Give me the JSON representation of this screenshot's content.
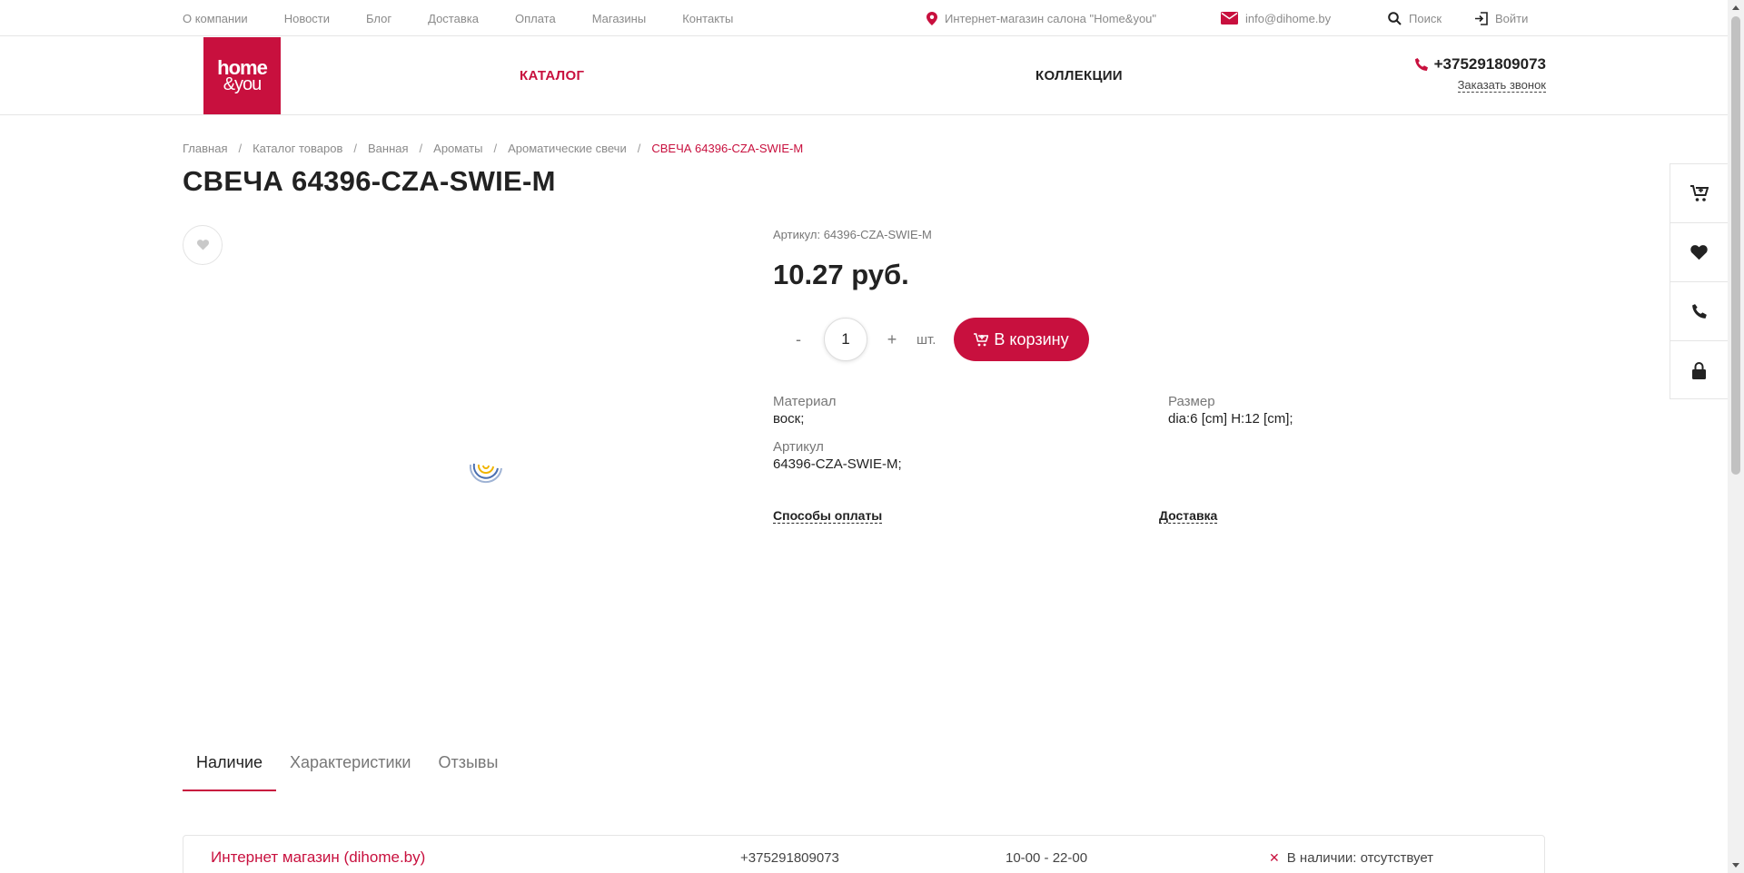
{
  "topnav": {
    "items": [
      "О компании",
      "Новости",
      "Блог",
      "Доставка",
      "Оплата",
      "Магазины",
      "Контакты"
    ]
  },
  "topinfo": {
    "store": "Интернет-магазин салона \"Home&you\"",
    "email": "info@dihome.by",
    "search": "Поиск",
    "login": "Войти"
  },
  "header": {
    "logo_line1": "home",
    "logo_line2": "&you",
    "catalog": "КАТАЛОГ",
    "collections": "КОЛЛЕКЦИИ",
    "phone": "+375291809073",
    "callback": "Заказать звонок"
  },
  "breadcrumb": {
    "items": [
      "Главная",
      "Каталог товаров",
      "Ванная",
      "Ароматы",
      "Ароматические свечи"
    ],
    "current": "СВЕЧА 64396-CZA-SWIE-M"
  },
  "product": {
    "title": "СВЕЧА 64396-CZA-SWIE-M",
    "sku_label": "Артикул: 64396-CZA-SWIE-M",
    "price": "10.27 руб.",
    "qty_minus": "-",
    "qty_value": "1",
    "qty_plus": "+",
    "unit": "шт.",
    "cart_button": "В корзину",
    "props": [
      {
        "label": "Материал",
        "value": "воск;"
      },
      {
        "label": "Размер",
        "value": "dia:6 [cm] H:12 [cm];"
      },
      {
        "label": "Артикул",
        "value": "64396-CZA-SWIE-M;"
      }
    ],
    "payment_link": "Способы оплаты",
    "delivery_link": "Доставка"
  },
  "tabs": [
    "Наличие",
    "Характеристики",
    "Отзывы"
  ],
  "store_row": {
    "name": "Интернет магазин (dihome.by)",
    "phone": "+375291809073",
    "hours": "10-00 - 22-00",
    "availability": "В наличии: отсутствует"
  },
  "colors": {
    "accent": "#c8103e",
    "text": "#222222",
    "muted": "#8a8a8a"
  },
  "icons": {
    "location": "map-pin-icon",
    "email": "envelope-icon",
    "search": "search-icon",
    "login": "login-icon",
    "phone": "phone-icon",
    "favorite": "heart-icon",
    "cart": "cart-icon",
    "lock": "lock-icon"
  }
}
